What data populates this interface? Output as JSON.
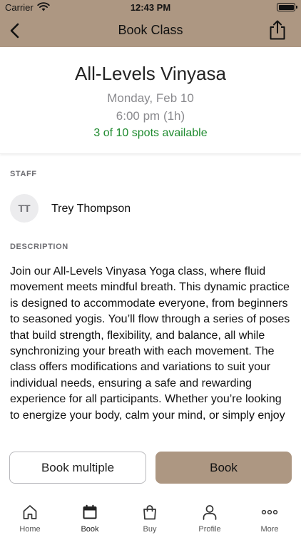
{
  "status_bar": {
    "carrier": "Carrier",
    "time": "12:43 PM"
  },
  "nav": {
    "title": "Book Class",
    "back_icon": "chevron-left-icon",
    "share_icon": "share-icon"
  },
  "class": {
    "name": "All-Levels Vinyasa",
    "date": "Monday, Feb 10",
    "time": "6:00 pm (1h)",
    "spots": "3 of 10 spots available"
  },
  "staff": {
    "label": "STAFF",
    "initials": "TT",
    "name": "Trey Thompson"
  },
  "description": {
    "label": "DESCRIPTION",
    "text": "Join our All-Levels Vinyasa Yoga class, where fluid movement meets mindful breath. This dynamic practice is designed to accommodate everyone, from beginners to seasoned yogis. You’ll flow through a series of poses that build strength, flexibility, and balance, all while synchronizing your breath with each movement. The class offers modifications and variations to suit your individual needs, ensuring a safe and rewarding experience for all participants. Whether you’re looking to energize your body, calm your mind, or simply enjoy"
  },
  "actions": {
    "book_multiple": "Book multiple",
    "book": "Book"
  },
  "tabs": [
    {
      "label": "Home",
      "icon": "home-icon"
    },
    {
      "label": "Book",
      "icon": "calendar-icon",
      "active": true
    },
    {
      "label": "Buy",
      "icon": "shopping-bag-icon"
    },
    {
      "label": "Profile",
      "icon": "person-icon"
    },
    {
      "label": "More",
      "icon": "more-icon"
    }
  ],
  "colors": {
    "accent": "#ad9782",
    "spots_available": "#1e8a2e",
    "muted_text": "#8a8a8e"
  }
}
